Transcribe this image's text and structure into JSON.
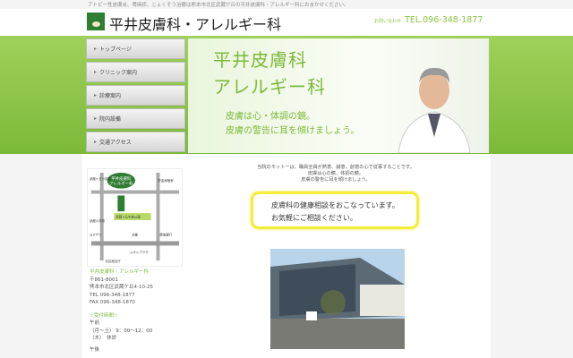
{
  "top_text": "アトピー性皮膚炎、蕁麻疹、じょくそう治療は熊本市北区武蔵ケ丘の平井皮膚科・アレルギー科におまかせください。",
  "header": {
    "title": "平井皮膚科・アレルギー科",
    "contact_label": "お問い合わせ",
    "tel": "TEL.096-348-1877"
  },
  "nav": [
    {
      "label": "トップページ"
    },
    {
      "label": "クリニック案内"
    },
    {
      "label": "診療案内"
    },
    {
      "label": "院内設備"
    },
    {
      "label": "交通アクセス"
    }
  ],
  "hero": {
    "title1": "平井皮膚科",
    "title2": "アレルギー科",
    "sub1": "皮膚は心・体調の鏡。",
    "sub2": "皮膚の警告に耳を傾けましょう。"
  },
  "map": {
    "clinic1": "平井皮膚科",
    "clinic2": "アレルギー科",
    "labels": [
      "武蔵ヶ丘小学校",
      "貯金局宿舎",
      "武蔵ヶ丘中央公園",
      "武蔵小学校",
      "ヨチザワ",
      "交番",
      "肥後銀行",
      "ムサシプラザ",
      "北区総合庁"
    ]
  },
  "sidebar": {
    "name": "平井皮膚科・アレルギー科",
    "zip": "〒861-8001",
    "address": "熊本市北区武蔵ケ丘4-10-25",
    "tel": "TEL 096-348-1877",
    "fax": "FAX 096-348-1870",
    "hours_title": "☆受付時間☆",
    "am": "午前",
    "weekday": "（月〜土） 9：00〜12：00",
    "thu": "（木）　休診",
    "pm": "午後"
  },
  "main": {
    "motto": [
      "当院のモットーは、職員全員が熱意、誠意、創意の心で従事することです。",
      "皮膚は心の鏡、体調の鏡。",
      "皮膚の警告に耳を傾けましょう。"
    ],
    "notice1": "皮膚科の健康相談をおこなっています。",
    "notice2": "お気軽にご相談ください。"
  }
}
